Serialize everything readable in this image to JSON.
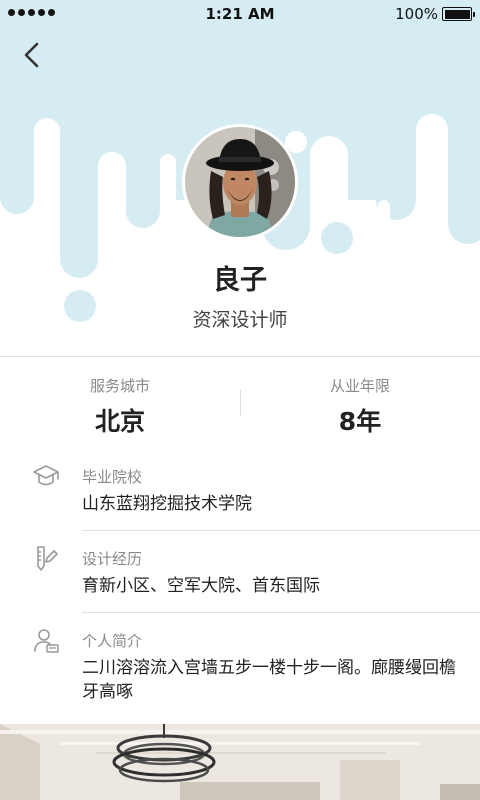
{
  "status_bar": {
    "time": "1:21 AM",
    "battery_percent": "100%",
    "signal_icon": "signal-dots-icon",
    "battery_icon": "battery-full-icon"
  },
  "nav": {
    "back_icon": "chevron-left-icon"
  },
  "profile": {
    "name": "良子",
    "title": "资深设计师",
    "avatar_icon": "avatar-photo"
  },
  "stats": {
    "city_label": "服务城市",
    "city_value": "北京",
    "years_label": "从业年限",
    "years_value": "8年"
  },
  "details": {
    "school_label": "毕业院校",
    "school_value": "山东蓝翔挖掘技术学院",
    "school_icon": "graduation-cap-icon",
    "experience_label": "设计经历",
    "experience_value": "育新小区、空军大院、首东国际",
    "experience_icon": "design-tools-icon",
    "intro_label": "个人简介",
    "intro_value": "二川溶溶流入宫墙五步一楼十步一阁。廊腰缦回檐牙高啄",
    "intro_icon": "person-card-icon"
  },
  "colors": {
    "hero_drip": "#d6ecf3",
    "accent_text": "#222222",
    "secondary_text": "#8a8a8a"
  }
}
